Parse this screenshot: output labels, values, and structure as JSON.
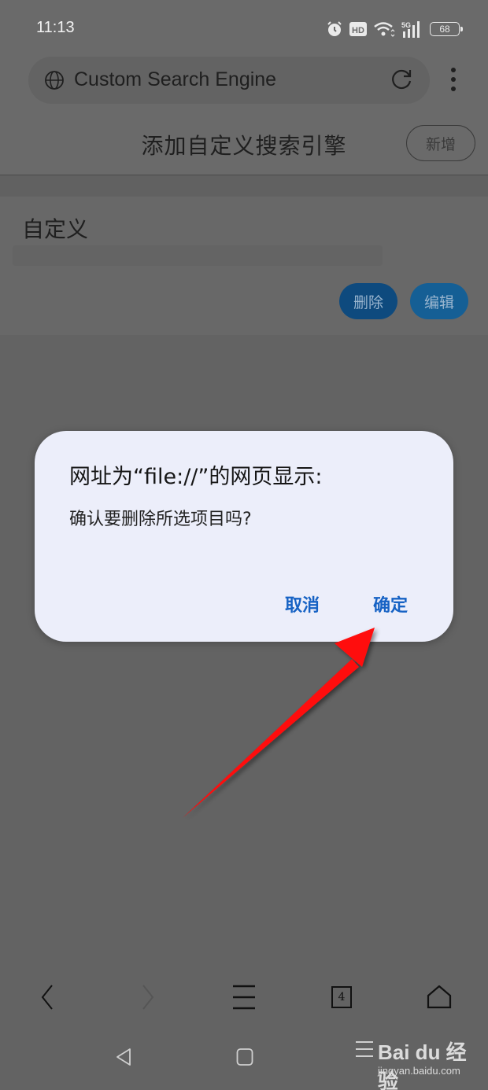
{
  "status_bar": {
    "time": "11:13",
    "icons": [
      "alarm-icon",
      "hd-icon",
      "wifi-icon",
      "5g-signal-icon"
    ],
    "network_label": "5G",
    "hd_label": "HD",
    "battery_level": "68"
  },
  "browser": {
    "address_bar_text": "Custom Search Engine",
    "address_icon": "globe-icon",
    "reload_icon": "reload-icon",
    "menu_icon": "more-vertical-icon"
  },
  "page": {
    "title": "添加自定义搜索引擎",
    "add_button_label": "新增",
    "engines": [
      {
        "name": "自定义",
        "delete_label": "删除",
        "edit_label": "编辑"
      }
    ]
  },
  "dialog": {
    "title": "网址为“file://”的网页显示:",
    "message": "确认要删除所选项目吗?",
    "cancel_label": "取消",
    "confirm_label": "确定"
  },
  "annotation": {
    "arrow_color": "#ff0a0a",
    "points_to": "确定"
  },
  "bottom_toolbar": {
    "items": [
      "back-icon",
      "forward-icon",
      "menu-icon",
      "tabs-icon",
      "home-icon"
    ],
    "tab_count": "4"
  },
  "system_nav": {
    "items": [
      "back-triangle-icon",
      "home-square-icon"
    ]
  },
  "watermark": {
    "brand": "Bai du 经验",
    "site": "jingyan.baidu.com"
  },
  "colors": {
    "dialog_bg": "#eceefa",
    "dialog_button": "#1662c4",
    "delete_button": "#0e4a7e",
    "edit_button": "#155f95",
    "dim_overlay": "#636363"
  }
}
